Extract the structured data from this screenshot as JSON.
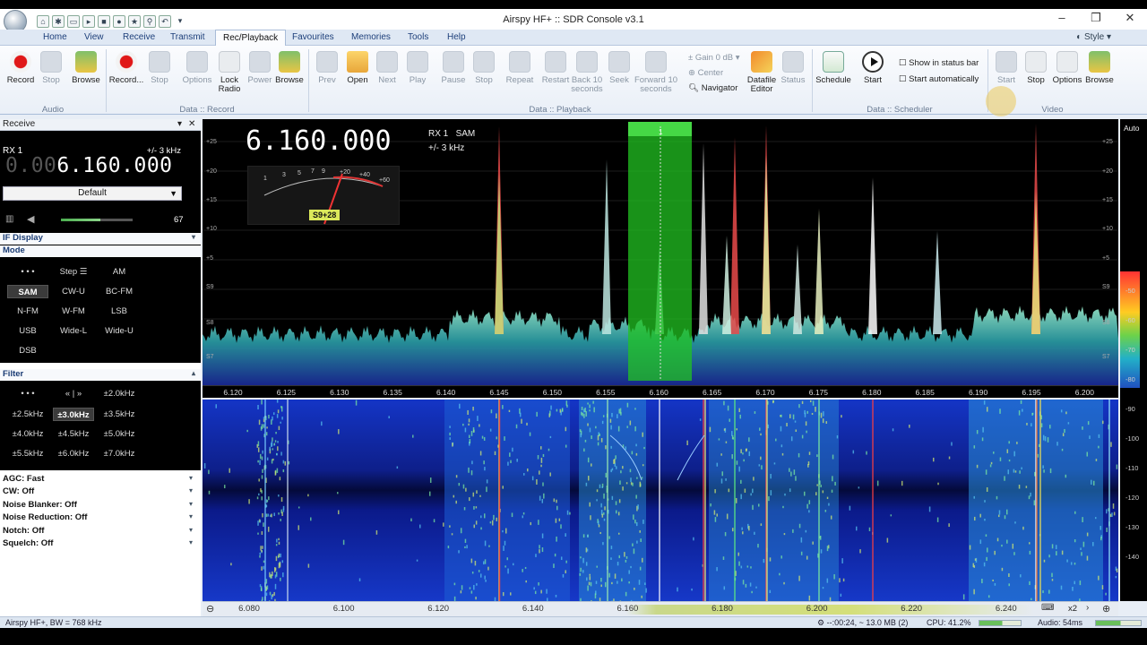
{
  "window": {
    "title": "Airspy HF+ :: SDR Console v3.1",
    "style_label": "Style"
  },
  "menu": [
    "Home",
    "View",
    "Receive",
    "Transmit",
    "Rec/Playback",
    "Favourites",
    "Memories",
    "Tools",
    "Help"
  ],
  "ribbon": {
    "audio": {
      "label": "Audio",
      "buttons": [
        "Record",
        "Stop",
        "Browse"
      ]
    },
    "record": {
      "label": "Data :: Record",
      "buttons": [
        "Record...",
        "Stop",
        "Options",
        "Lock Radio",
        "Power",
        "Browse"
      ]
    },
    "playback": {
      "label": "Data :: Playback",
      "buttons": [
        "Prev",
        "Open",
        "Next",
        "Play",
        "Pause",
        "Stop",
        "Repeat",
        "Restart",
        "Back 10 seconds",
        "Seek",
        "Forward 10 seconds"
      ],
      "gain": "Gain 0 dB",
      "center": "Center",
      "navigator": "Navigator",
      "datafile_editor": "Datafile Editor",
      "status": "Status"
    },
    "scheduler": {
      "label": "Data :: Scheduler",
      "buttons": [
        "Schedule",
        "Start"
      ],
      "check1": "Show in status bar",
      "check2": "Start automatically"
    },
    "video": {
      "label": "Video",
      "buttons": [
        "Start",
        "Stop",
        "Options",
        "Browse"
      ]
    }
  },
  "receive": {
    "header": "Receive",
    "rx_label": "RX 1",
    "bandwidth": "+/- 3 kHz",
    "freq_dim": "0.00",
    "freq_main": "6.160.000",
    "preset": "Default",
    "volume": "67",
    "volume_level": 0.55
  },
  "if_display": "IF Display",
  "mode": {
    "title": "Mode",
    "buttons": [
      "• • •",
      "Step ☰",
      "AM",
      "SAM",
      "CW-U",
      "BC-FM",
      "N-FM",
      "W-FM",
      "LSB",
      "USB",
      "Wide-L",
      "Wide-U",
      "DSB"
    ],
    "selected": "SAM"
  },
  "filter": {
    "title": "Filter",
    "buttons": [
      "• • •",
      "« | »",
      "±2.0kHz",
      "±2.5kHz",
      "±3.0kHz",
      "±3.5kHz",
      "±4.0kHz",
      "±4.5kHz",
      "±5.0kHz",
      "±5.5kHz",
      "±6.0kHz",
      "±7.0kHz"
    ],
    "selected": "±3.0kHz"
  },
  "options": [
    "AGC: Fast",
    "CW: Off",
    "Noise Blanker: Off",
    "Noise Reduction: Off",
    "Notch: Off",
    "Squelch: Off"
  ],
  "spectrum": {
    "freq": "6.160.000",
    "rx": "RX 1",
    "mode": "SAM",
    "bw": "+/- 3 kHz",
    "smeter": "S9+28",
    "meter_scale": [
      "1",
      "3",
      "5",
      "7",
      "9",
      "+20",
      "+40",
      "+60"
    ],
    "db_scale": [
      "+25",
      "+20",
      "+15",
      "+10",
      "+5",
      "S9",
      "S8",
      "S7"
    ],
    "axis": [
      "6.120",
      "6.125",
      "6.130",
      "6.135",
      "6.140",
      "6.145",
      "6.150",
      "6.155",
      "6.160",
      "6.165",
      "6.170",
      "6.175",
      "6.180",
      "6.185",
      "6.190",
      "6.195",
      "6.200"
    ],
    "marker": "1",
    "auto": "Auto",
    "right_scale": [
      "-50",
      "-60",
      "-70",
      "-80",
      "-90",
      "-100",
      "-110",
      "-120",
      "-130",
      "-140"
    ]
  },
  "waterfall_axis": [
    "6.080",
    "6.100",
    "6.120",
    "6.140",
    "6.160",
    "6.180",
    "6.200",
    "6.220",
    "6.240"
  ],
  "zoom": "x2",
  "status": {
    "left": "Airspy HF+, BW = 768 kHz",
    "time": "--:00:24, ~ 13.0 MB (2)",
    "cpu": "CPU: 41.2%",
    "audio": "Audio: 54ms",
    "cpu_level": 0.55
  },
  "colors": {
    "accent": "#1d3f7a",
    "passband": "#22c322",
    "spectrum_fill": "#2c58b8"
  }
}
